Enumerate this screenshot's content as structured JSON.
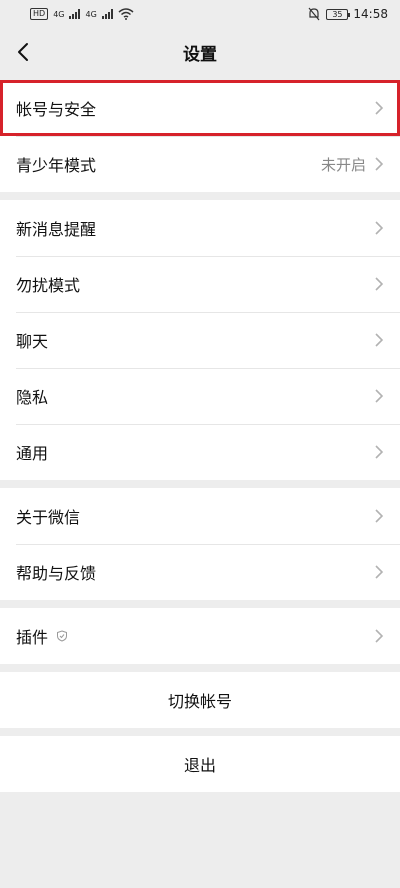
{
  "status_bar": {
    "hd1": "HD",
    "net1": "4G",
    "net2": "4G",
    "battery": "35",
    "time": "14:58"
  },
  "header": {
    "title": "设置"
  },
  "groups": [
    [
      {
        "label": "帐号与安全",
        "value": ""
      },
      {
        "label": "青少年模式",
        "value": "未开启"
      }
    ],
    [
      {
        "label": "新消息提醒",
        "value": ""
      },
      {
        "label": "勿扰模式",
        "value": ""
      },
      {
        "label": "聊天",
        "value": ""
      },
      {
        "label": "隐私",
        "value": ""
      },
      {
        "label": "通用",
        "value": ""
      }
    ],
    [
      {
        "label": "关于微信",
        "value": ""
      },
      {
        "label": "帮助与反馈",
        "value": ""
      }
    ],
    [
      {
        "label": "插件",
        "value": ""
      }
    ]
  ],
  "actions": {
    "switch_account": "切换帐号",
    "logout": "退出"
  },
  "colors": {
    "highlight": "#d6222a",
    "background": "#ededed"
  }
}
